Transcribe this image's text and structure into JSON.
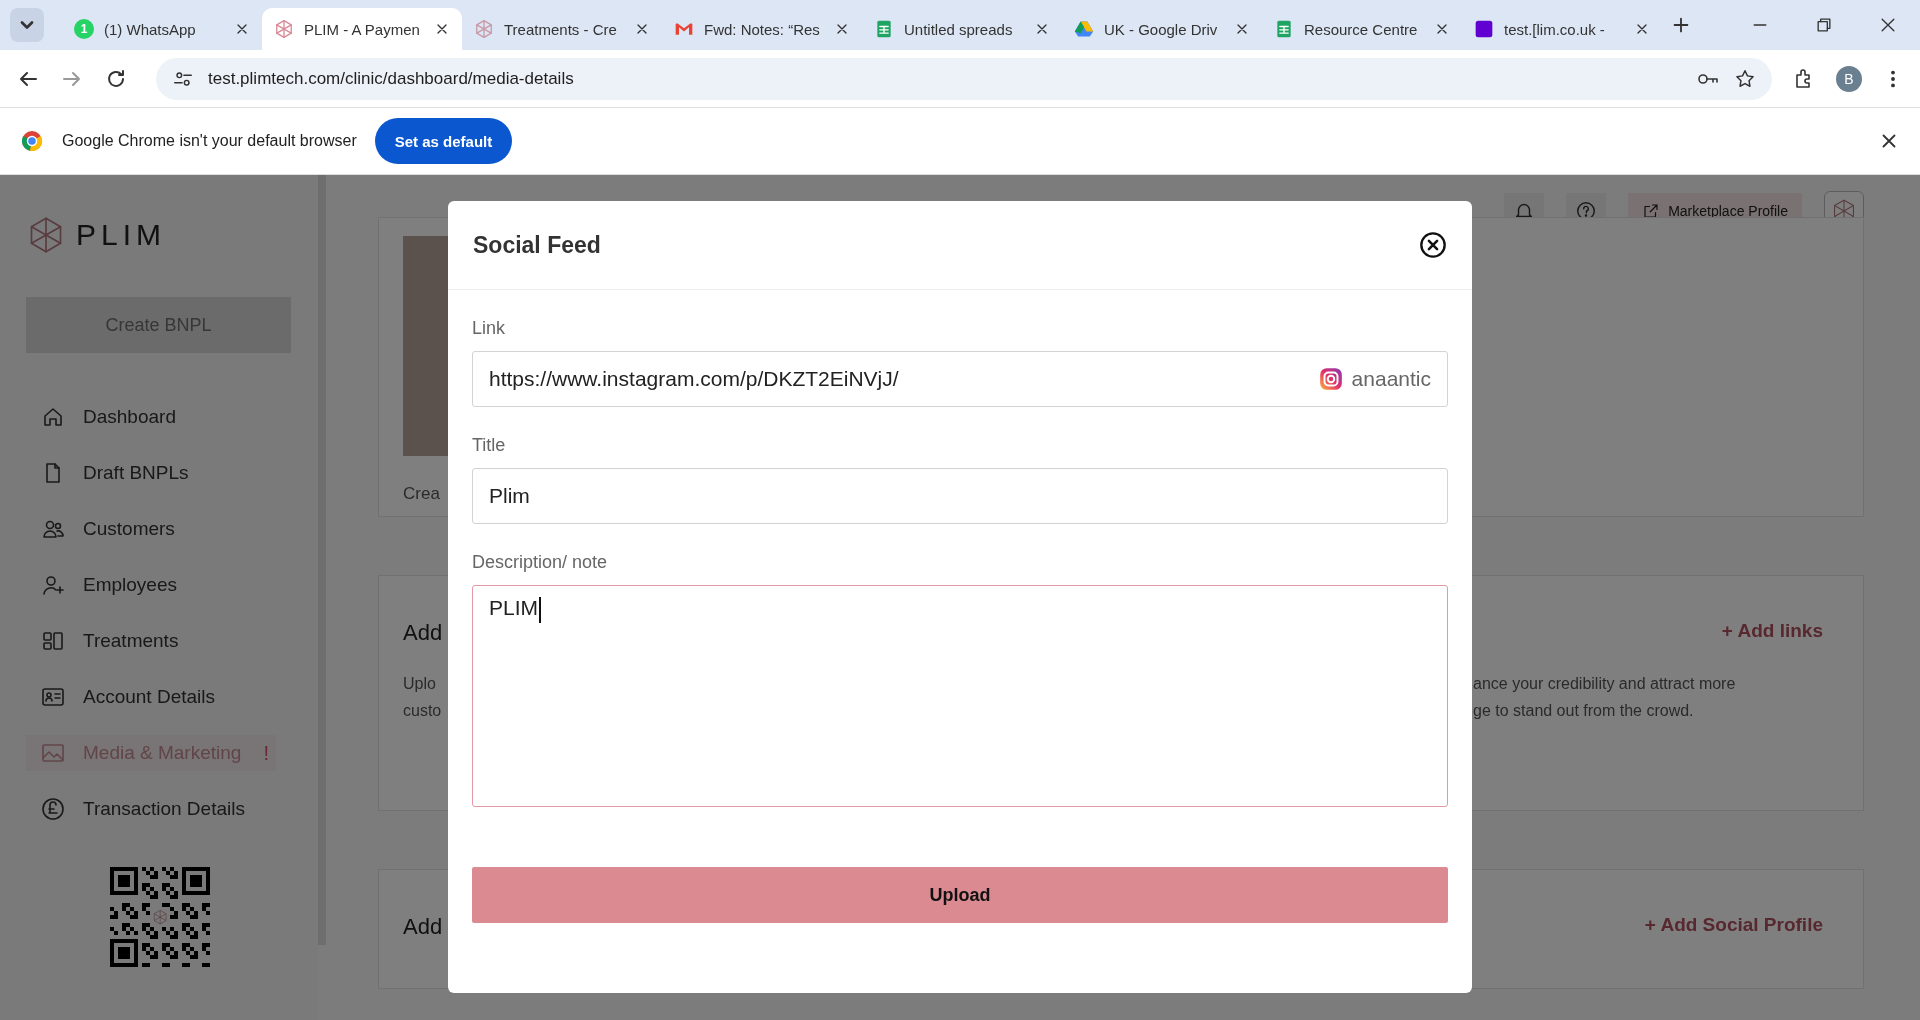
{
  "browser": {
    "tabs": [
      {
        "title": "(1) WhatsApp",
        "badge": "1",
        "selected": false
      },
      {
        "title": "PLIM - A Paymen",
        "selected": true
      },
      {
        "title": "Treatments - Cre",
        "selected": false
      },
      {
        "title": "Fwd: Notes: “Res",
        "selected": false
      },
      {
        "title": "Untitled spreads",
        "selected": false
      },
      {
        "title": "UK - Google Driv",
        "selected": false
      },
      {
        "title": "Resource Centre",
        "selected": false
      },
      {
        "title": "test.[lim.co.uk -",
        "selected": false
      }
    ],
    "address": "test.plimtech.com/clinic/dashboard/media-details",
    "profile": "B"
  },
  "infobar": {
    "message": "Google Chrome isn't your default browser",
    "button": "Set as default"
  },
  "sidebar": {
    "logo": "PLIM",
    "create_button": {
      "label": "Create BNPL",
      "disabled": true
    },
    "items": [
      {
        "label": "Dashboard",
        "selected": false
      },
      {
        "label": "Draft BNPLs",
        "selected": false
      },
      {
        "label": "Customers",
        "selected": false
      },
      {
        "label": "Employees",
        "selected": false
      },
      {
        "label": "Treatments",
        "selected": false
      },
      {
        "label": "Account Details",
        "selected": false
      },
      {
        "label": "Media & Marketing",
        "selected": true,
        "alert": "!"
      },
      {
        "label": "Transaction Details",
        "selected": false
      }
    ]
  },
  "header": {
    "marketplace_button": "Marketplace Profile"
  },
  "background": {
    "photo_caption": "Crea",
    "links_card": {
      "title": "Add",
      "text_left": [
        "Uplo",
        "custo"
      ],
      "text_right": [
        "ance your credibility and attract more",
        "ge to stand out from the crowd."
      ],
      "action": "+ Add links"
    },
    "social_card": {
      "title": "Add",
      "action": "+ Add Social Profile"
    }
  },
  "modal": {
    "title": "Social Feed",
    "fields": [
      {
        "kind": "link",
        "label": "Link",
        "value": "https://www.instagram.com/p/DKZT2EiNVjJ/",
        "handle": "anaantic",
        "focused": false
      },
      {
        "kind": "text",
        "label": "Title",
        "value": "Plim",
        "focused": false
      },
      {
        "kind": "textarea",
        "label": "Description/ note",
        "value": "PLIM",
        "focused": true
      }
    ],
    "button": "Upload"
  }
}
